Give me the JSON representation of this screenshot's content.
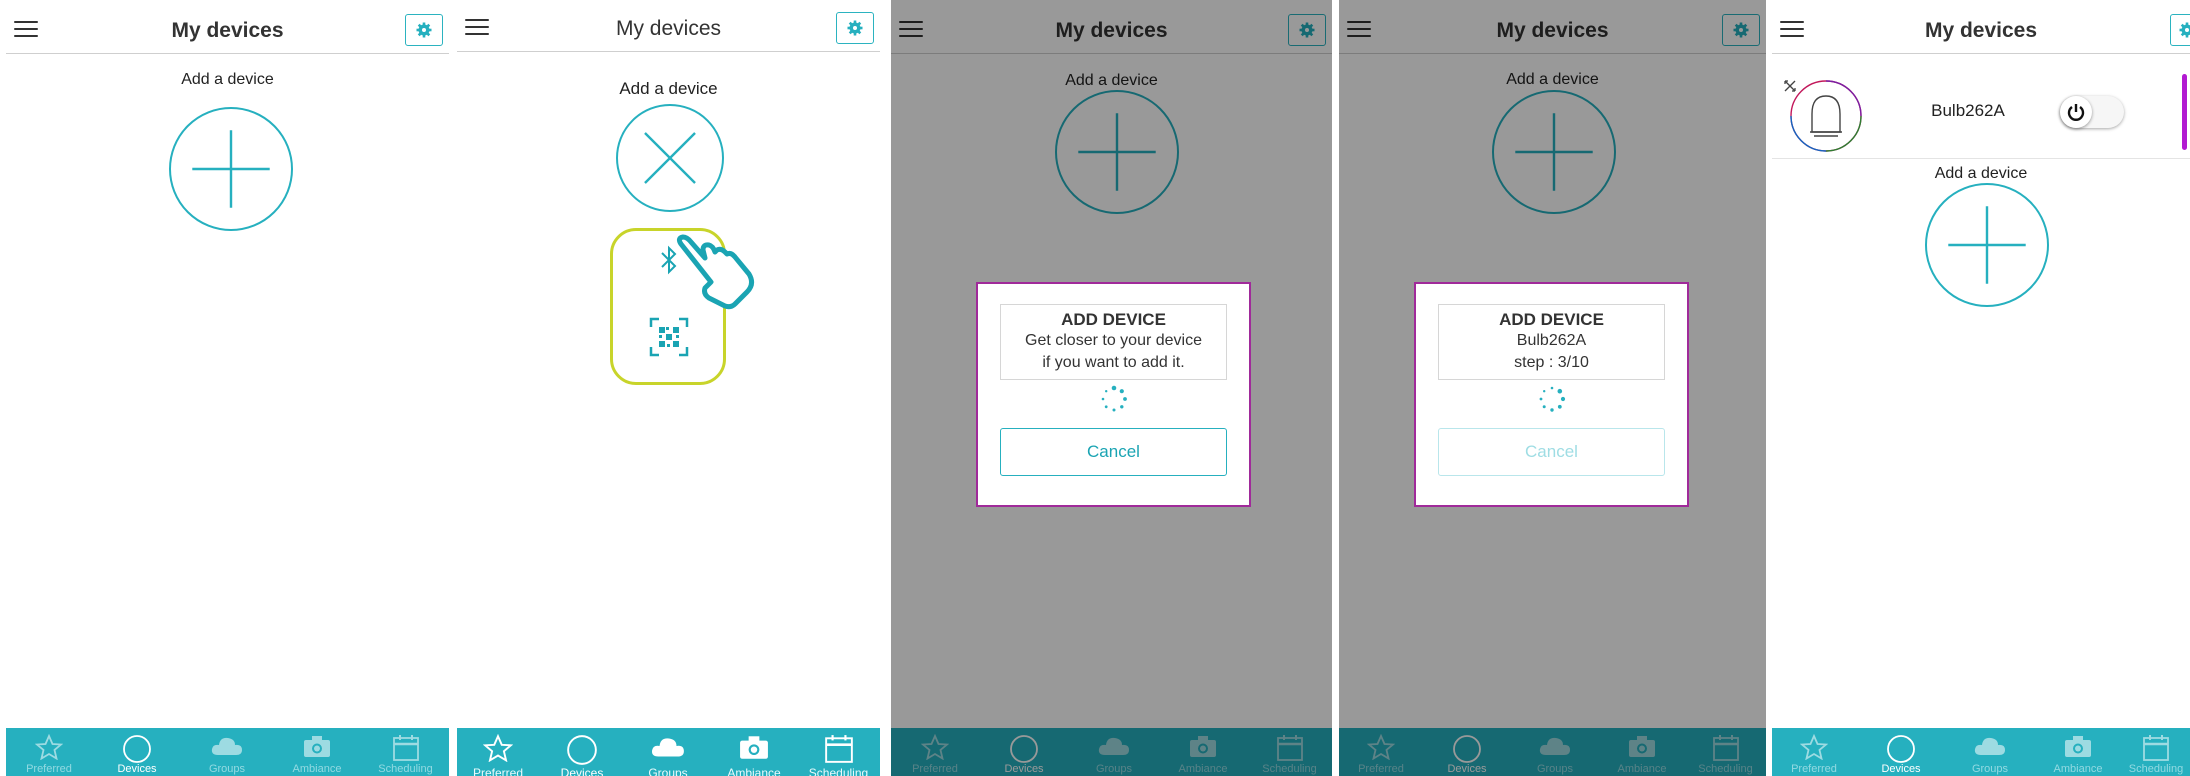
{
  "colors": {
    "accent": "#26b0bf",
    "dialog_border": "#a02a9a",
    "tabbar": "#26b0bf",
    "highlight_border": "#c8d42a",
    "scroll_indicator": "#b21ad1"
  },
  "header": {
    "title": "My devices",
    "menu_icon": "hamburger-menu-icon",
    "settings_icon": "gear-icon"
  },
  "add_device": {
    "label": "Add a device"
  },
  "tabs": [
    {
      "label": "Preferred",
      "icon": "star-icon"
    },
    {
      "label": "Devices",
      "icon": "circle-icon"
    },
    {
      "label": "Groups",
      "icon": "cloud-icon"
    },
    {
      "label": "Ambiance",
      "icon": "camera-icon"
    },
    {
      "label": "Scheduling",
      "icon": "calendar-icon"
    }
  ],
  "panel2": {
    "menu_options": [
      {
        "icon": "bluetooth-icon"
      },
      {
        "icon": "qr-code-icon"
      }
    ],
    "pointer": "hand-pointer-icon"
  },
  "panel3": {
    "dialog": {
      "title": "ADD DEVICE",
      "line1": "Get closer to your device",
      "line2": "if you want to add it.",
      "cancel": "Cancel"
    }
  },
  "panel4": {
    "dialog": {
      "title": "ADD DEVICE",
      "line1": "Bulb262A",
      "line2": "step : 3/10",
      "cancel": "Cancel"
    }
  },
  "panel5": {
    "device": {
      "name": "Bulb262A",
      "icon": "bulb-icon",
      "corner_icon": "expand-icon",
      "power_icon": "power-icon",
      "power_on": false
    }
  }
}
